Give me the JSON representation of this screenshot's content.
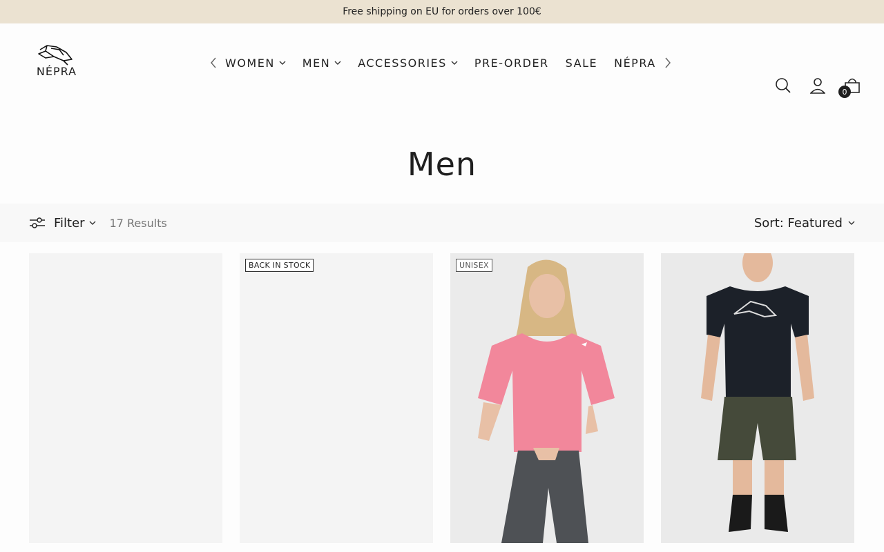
{
  "announcement": "Free shipping on EU for orders over 100€",
  "brand": "NÉPRA",
  "nav": {
    "items": [
      {
        "label": "WOMEN",
        "has_dropdown": true
      },
      {
        "label": "MEN",
        "has_dropdown": true
      },
      {
        "label": "ACCESSORIES",
        "has_dropdown": true
      },
      {
        "label": "PRE-ORDER",
        "has_dropdown": false
      },
      {
        "label": "SALE",
        "has_dropdown": false
      },
      {
        "label": "NÉPRA",
        "has_dropdown": false
      }
    ]
  },
  "header_icons": {
    "search": "search-icon",
    "account": "user-icon",
    "cart": "shopping-bag-icon",
    "cart_count": "0"
  },
  "page_title": "Men",
  "toolbar": {
    "filter_label": "Filter",
    "results": "17 Results",
    "sort_label": "Sort: Featured"
  },
  "products": [
    {
      "badge": ""
    },
    {
      "badge": "BACK IN STOCK"
    },
    {
      "badge": "UNISEX"
    },
    {
      "badge": ""
    }
  ],
  "colors": {
    "announcement_bg": "#ebe2d1",
    "text": "#1f1f1f",
    "card_bg": "#f3f3f3"
  }
}
